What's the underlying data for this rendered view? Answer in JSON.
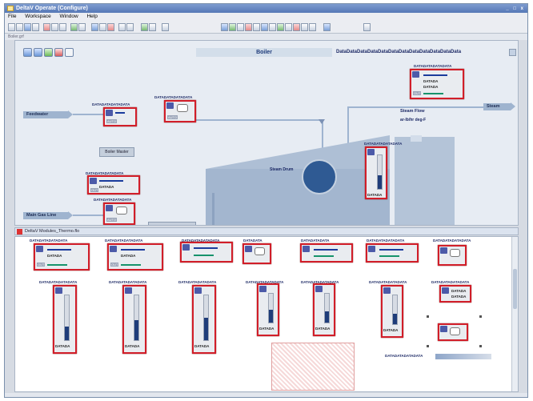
{
  "window": {
    "title": "DeltaV Operate (Configure)",
    "controls": "_ □ x"
  },
  "menu": {
    "items": [
      "File",
      "Workspace",
      "Window",
      "Help"
    ]
  },
  "toolbar": {
    "tool_icons": [
      "new-icon",
      "open-icon",
      "save-icon",
      "print-icon",
      "cut-icon",
      "copy-icon",
      "paste-icon",
      "undo-icon",
      "tool-icon",
      "help-icon",
      "run-icon",
      "stop-icon",
      "chart-icon",
      "zoom-icon",
      "grid-icon"
    ]
  },
  "tabs": {
    "main": "Boiler.grf"
  },
  "diagram": {
    "title": "Boiler",
    "banner_text": "DataDataDataDataDataDataDataDataDataDataDataData",
    "labels": {
      "feedwater": "Feedwater",
      "main_gas_line": "Main Gas Line",
      "steam": "Steam",
      "steam_flow": "Steam Flow",
      "steam_flow_units": "ar-lb/hr   deg-F",
      "steam_drum": "Steam Drum",
      "boiler_master": "Boiler Master"
    },
    "faceplate_titles": [
      "DATADATADATADATA",
      "DATADATADATADATA",
      "DATADATADATADATA",
      "DATADATADATADATA",
      "DATADATADATADATA",
      "DATADATADATADATA"
    ],
    "faceplate_value": "DATADA",
    "faceplate_mode": "AUTO",
    "faceplate_out": "OUT"
  },
  "panel2": {
    "title": "DeltaV Modules_Thermo.flo",
    "row1_titles": [
      "DATADATADATADATA",
      "DATADATADATADATA",
      "DATADATADATADATA",
      "DATADATA",
      "DATADATADATA",
      "DATADATADATADATA",
      "DATADATADATADATA"
    ],
    "row2_titles": [
      "DATADATADATADATA",
      "DATADATADATADATA",
      "DATADATADATADATA",
      "DATADATADATADATA",
      "DATADATADATADATA",
      "DATADATADATADATA",
      "DATADATADATADATA"
    ],
    "right_label": "DATADATADATADATA",
    "bottom_label": "DATADATADATADATA",
    "value_text": "DATADA"
  },
  "colors": {
    "faceplate_border": "#d11e29",
    "pipe": "#9fb4cf",
    "bar_fill": "#1f3d7a"
  }
}
